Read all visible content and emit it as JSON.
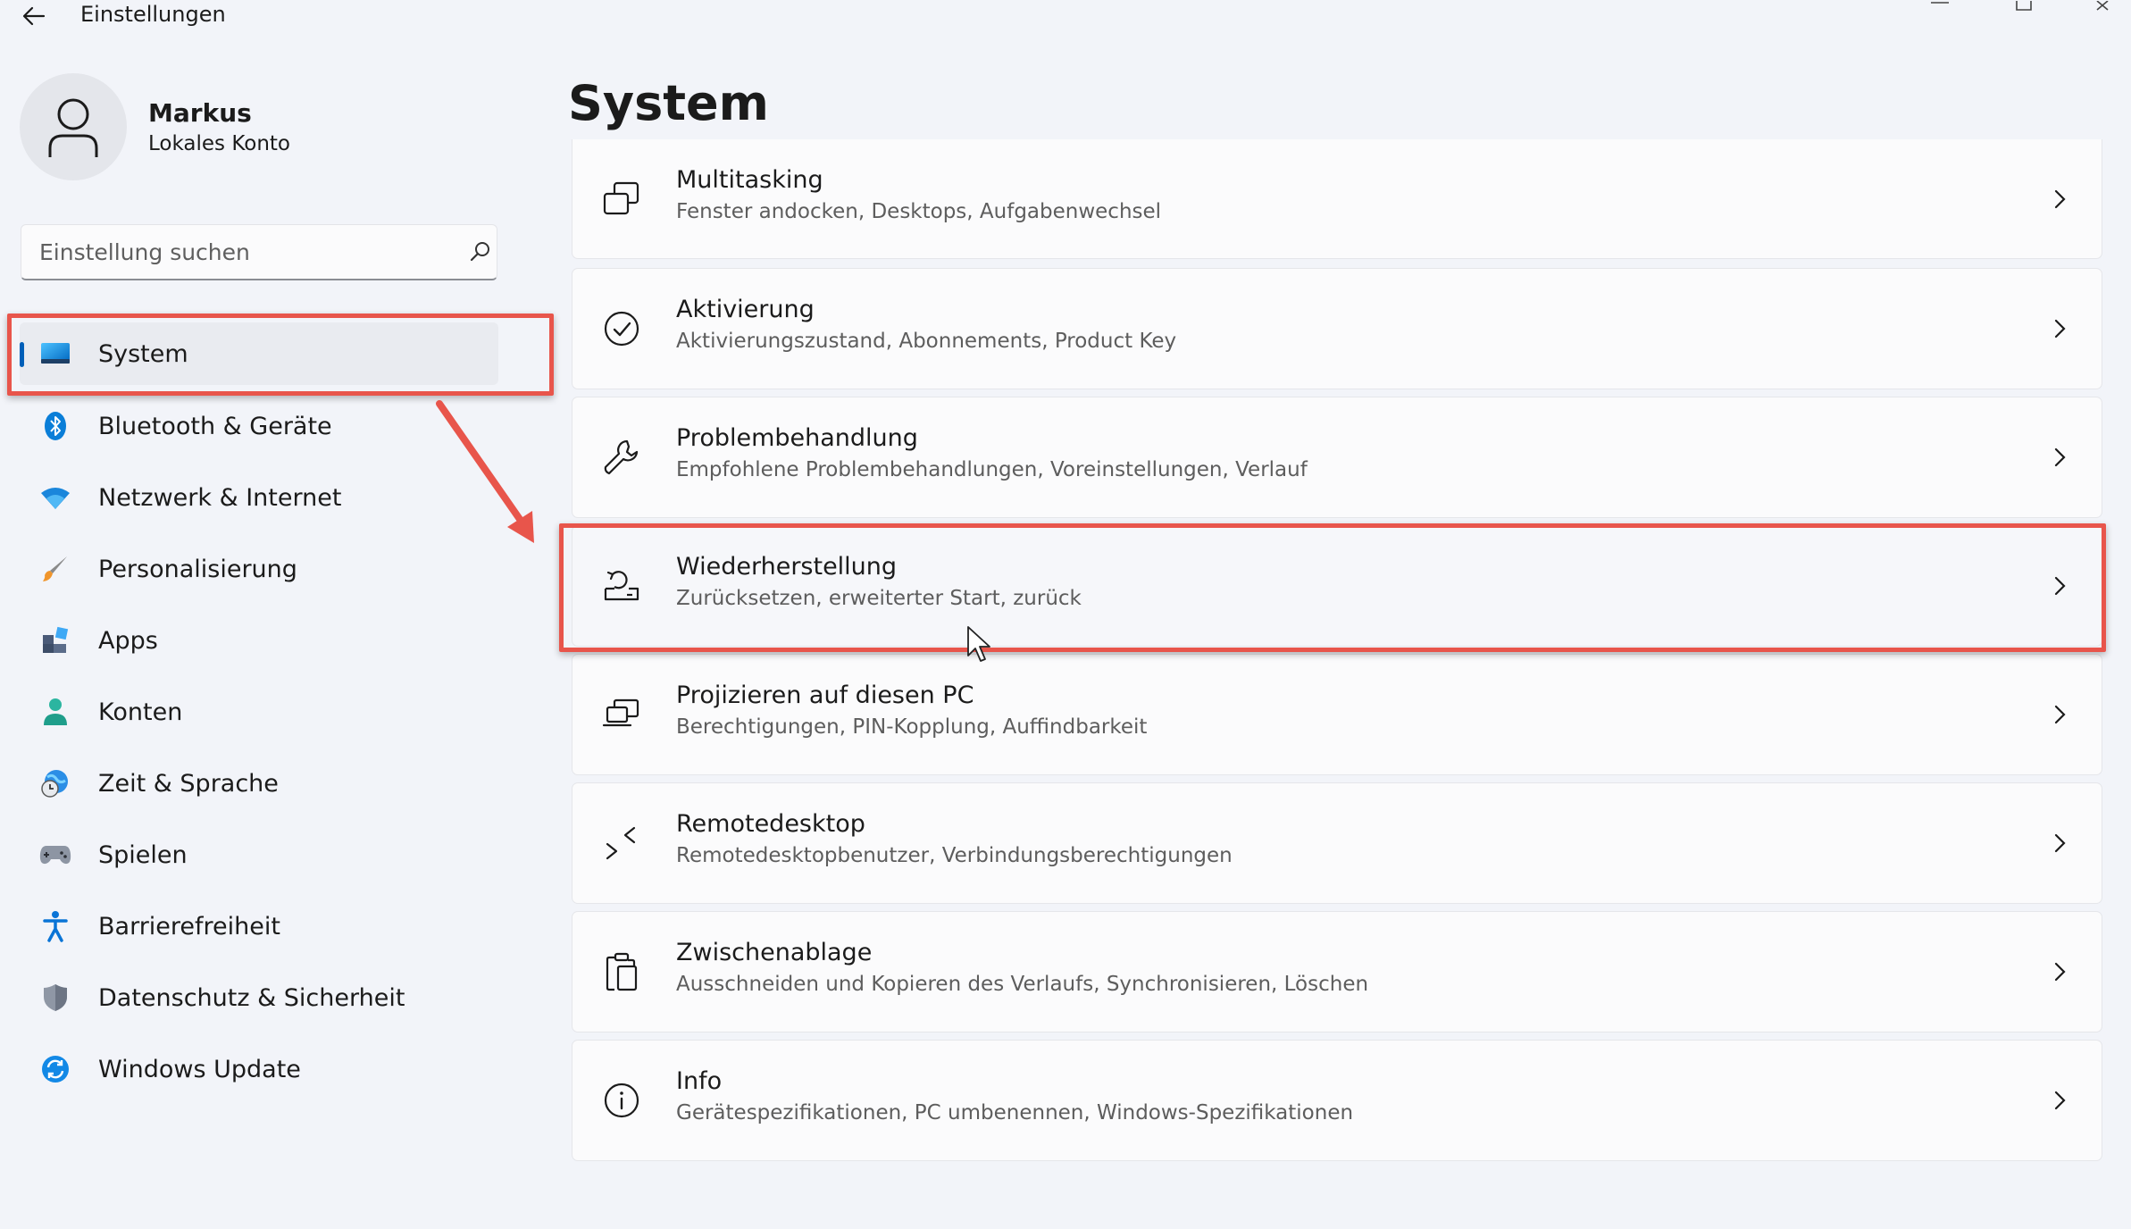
{
  "window": {
    "title": "Einstellungen",
    "back_icon": "arrow-left-icon",
    "minimize_icon": "minimize-icon",
    "maximize_icon": "maximize-icon",
    "close_icon": "close-icon"
  },
  "user": {
    "name": "Markus",
    "account_type": "Lokales Konto",
    "avatar_icon": "person-icon"
  },
  "search": {
    "placeholder": "Einstellung suchen",
    "value": "",
    "icon": "search-icon"
  },
  "sidebar": {
    "items": [
      {
        "label": "System",
        "icon": "monitor-icon",
        "active": true
      },
      {
        "label": "Bluetooth & Geräte",
        "icon": "bluetooth-icon"
      },
      {
        "label": "Netzwerk & Internet",
        "icon": "wifi-icon"
      },
      {
        "label": "Personalisierung",
        "icon": "paintbrush-icon"
      },
      {
        "label": "Apps",
        "icon": "apps-icon"
      },
      {
        "label": "Konten",
        "icon": "account-icon"
      },
      {
        "label": "Zeit & Sprache",
        "icon": "clock-globe-icon"
      },
      {
        "label": "Spielen",
        "icon": "gamepad-icon"
      },
      {
        "label": "Barrierefreiheit",
        "icon": "accessibility-icon"
      },
      {
        "label": "Datenschutz & Sicherheit",
        "icon": "shield-icon"
      },
      {
        "label": "Windows Update",
        "icon": "update-icon"
      }
    ]
  },
  "main": {
    "title": "System",
    "cards": [
      {
        "title": "Multitasking",
        "subtitle": "Fenster andocken, Desktops, Aufgabenwechsel",
        "icon": "multitasking-icon"
      },
      {
        "title": "Aktivierung",
        "subtitle": "Aktivierungszustand, Abonnements, Product Key",
        "icon": "check-circle-icon"
      },
      {
        "title": "Problembehandlung",
        "subtitle": "Empfohlene Problembehandlungen, Voreinstellungen, Verlauf",
        "icon": "wrench-icon"
      },
      {
        "title": "Wiederherstellung",
        "subtitle": "Zurücksetzen, erweiterter Start, zurück",
        "icon": "recovery-icon",
        "highlighted": true
      },
      {
        "title": "Projizieren auf diesen PC",
        "subtitle": "Berechtigungen, PIN-Kopplung, Auffindbarkeit",
        "icon": "project-icon"
      },
      {
        "title": "Remotedesktop",
        "subtitle": "Remotedesktopbenutzer, Verbindungsberechtigungen",
        "icon": "remote-desktop-icon"
      },
      {
        "title": "Zwischenablage",
        "subtitle": "Ausschneiden und Kopieren des Verlaufs, Synchronisieren, Löschen",
        "icon": "clipboard-icon"
      },
      {
        "title": "Info",
        "subtitle": "Gerätespezifikationen, PC umbenennen, Windows-Spezifikationen",
        "icon": "info-icon"
      }
    ]
  },
  "colors": {
    "background": "#f2f4f9",
    "card": "#fbfbfc",
    "accent": "#005fb8",
    "annotation": "#e8554b"
  }
}
